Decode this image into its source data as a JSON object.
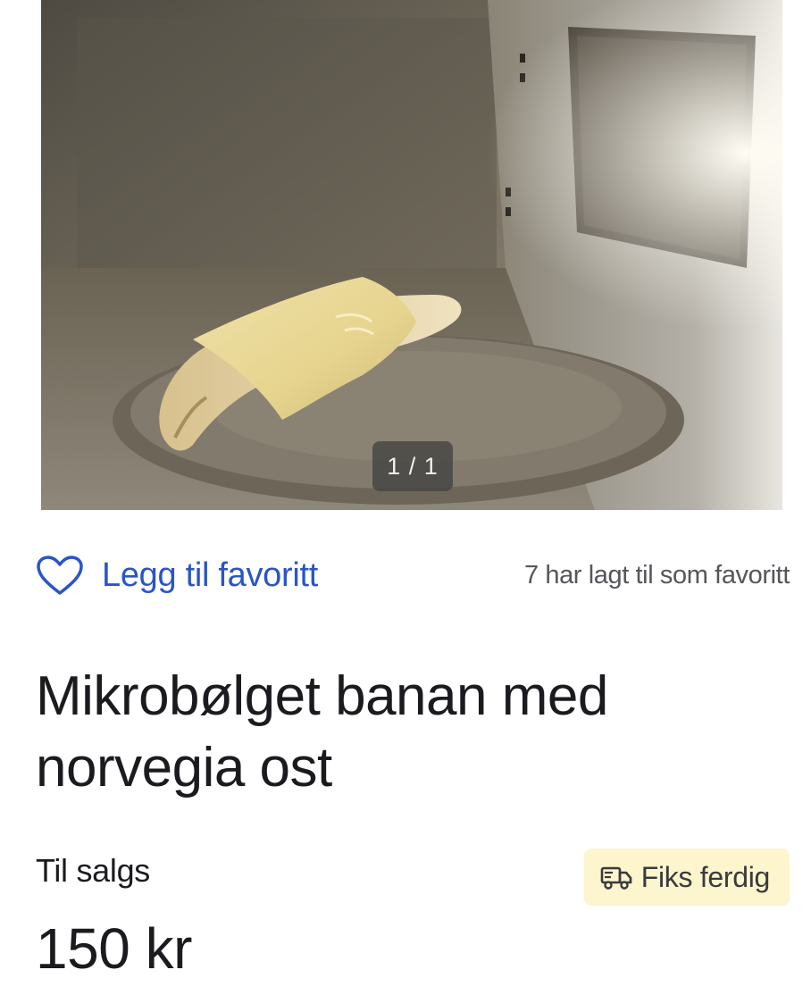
{
  "gallery": {
    "counter": "1 / 1",
    "image_subject": "banana wrapped in cheese slice on microwave turntable"
  },
  "favorite": {
    "button_label": "Legg til favoritt",
    "count_text": "7 har lagt til som favoritt",
    "icon": "heart-outline-icon",
    "color": "#2a55c5"
  },
  "listing": {
    "title": "Mikrobølget banan med norvegia ost",
    "status": "Til salgs",
    "price": "150 kr"
  },
  "shipping_badge": {
    "label": "Fiks ferdig",
    "icon": "delivery-truck-icon",
    "background": "#fcf5cd"
  }
}
